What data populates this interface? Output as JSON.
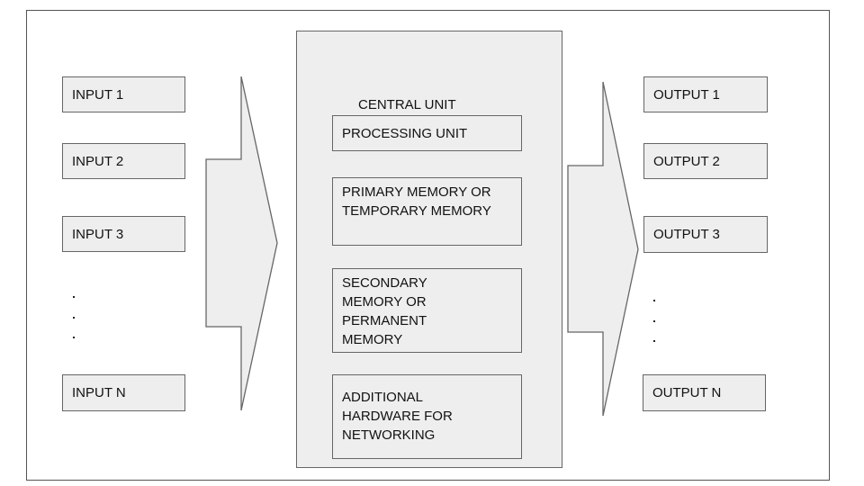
{
  "diagram": {
    "inputs": [
      "INPUT 1",
      "INPUT 2",
      "INPUT 3",
      "INPUT N"
    ],
    "outputs": [
      "OUTPUT 1",
      "OUTPUT 2",
      "OUTPUT 3",
      "OUTPUT N"
    ],
    "ellipsis": ".",
    "central_unit": {
      "title": "CENTRAL UNIT",
      "components": [
        "PROCESSING UNIT",
        "PRIMARY MEMORY OR TEMPORARY MEMORY",
        "SECONDARY MEMORY OR PERMANENT MEMORY",
        "ADDITIONAL HARDWARE FOR NETWORKING"
      ]
    },
    "colors": {
      "box_fill": "#eeeeee",
      "stroke": "#666666",
      "text": "#111111"
    }
  }
}
